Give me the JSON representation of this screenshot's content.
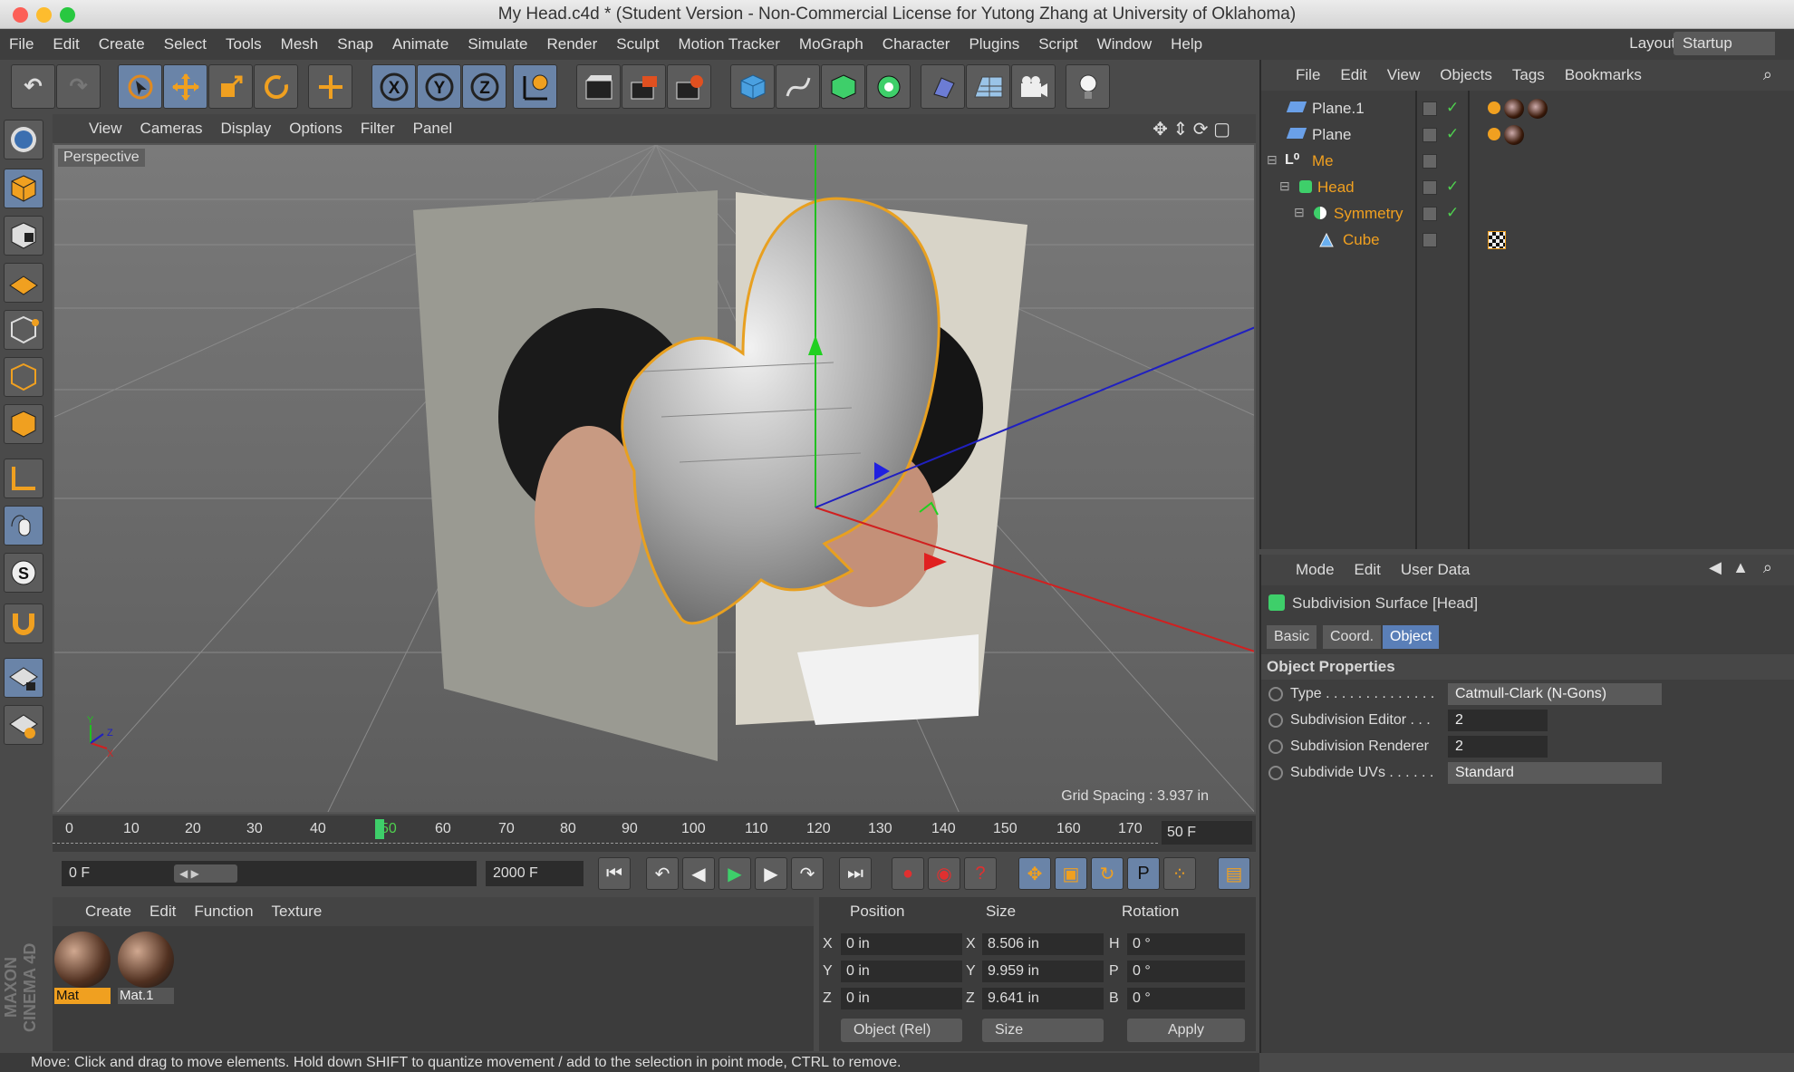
{
  "window": {
    "title": "My Head.c4d * (Student Version - Non-Commercial License for Yutong Zhang at University of Oklahoma)"
  },
  "menubar": {
    "items": [
      "File",
      "Edit",
      "Create",
      "Select",
      "Tools",
      "Mesh",
      "Snap",
      "Animate",
      "Simulate",
      "Render",
      "Sculpt",
      "Motion Tracker",
      "MoGraph",
      "Character",
      "Plugins",
      "Script",
      "Window",
      "Help"
    ],
    "layout_label": "Layout:",
    "layout_value": "Startup"
  },
  "viewport": {
    "menu": [
      "View",
      "Cameras",
      "Display",
      "Options",
      "Filter",
      "Panel"
    ],
    "camera": "Perspective",
    "grid_spacing": "Grid Spacing : 3.937 in"
  },
  "timeline": {
    "ticks": [
      "0",
      "10",
      "20",
      "30",
      "40",
      "50",
      "60",
      "70",
      "80",
      "90",
      "100",
      "110",
      "120",
      "130",
      "140",
      "150",
      "160",
      "170"
    ],
    "current_marker": "50",
    "frame_field": "50 F"
  },
  "playback": {
    "start": "0 F",
    "end": "2000 F"
  },
  "materials": {
    "menu": [
      "Create",
      "Edit",
      "Function",
      "Texture"
    ],
    "items": [
      "Mat",
      "Mat.1"
    ]
  },
  "coords": {
    "headers": [
      "Position",
      "Size",
      "Rotation"
    ],
    "rows": [
      {
        "axis": "X",
        "pos": "0 in",
        "saxis": "X",
        "size": "8.506 in",
        "raxis": "H",
        "rot": "0 °"
      },
      {
        "axis": "Y",
        "pos": "0 in",
        "saxis": "Y",
        "size": "9.959 in",
        "raxis": "P",
        "rot": "0 °"
      },
      {
        "axis": "Z",
        "pos": "0 in",
        "saxis": "Z",
        "size": "9.641 in",
        "raxis": "B",
        "rot": "0 °"
      }
    ],
    "mode": "Object (Rel)",
    "size_mode": "Size",
    "apply": "Apply"
  },
  "status": "Move: Click and drag to move elements. Hold down SHIFT to quantize movement / add to the selection in point mode, CTRL to remove.",
  "branding": "MAXON CINEMA 4D",
  "objects": {
    "menu": [
      "File",
      "Edit",
      "View",
      "Objects",
      "Tags",
      "Bookmarks"
    ],
    "items": [
      "Plane.1",
      "Plane",
      "Me",
      "Head",
      "Symmetry",
      "Cube"
    ]
  },
  "attributes": {
    "menu": [
      "Mode",
      "Edit",
      "User Data"
    ],
    "title": "Subdivision Surface [Head]",
    "tabs": [
      "Basic",
      "Coord.",
      "Object"
    ],
    "section": "Object Properties",
    "props": [
      {
        "label": "Type . . . . . . . . . . . . . .",
        "value": "Catmull-Clark (N-Gons)"
      },
      {
        "label": "Subdivision Editor . . .",
        "value": "2"
      },
      {
        "label": "Subdivision Renderer",
        "value": "2"
      },
      {
        "label": "Subdivide UVs . . . . . .",
        "value": "Standard"
      }
    ]
  },
  "colors": {
    "accent_orange": "#f0a020",
    "selection_blue": "#5a7fb8",
    "check_green": "#4fd04f"
  }
}
